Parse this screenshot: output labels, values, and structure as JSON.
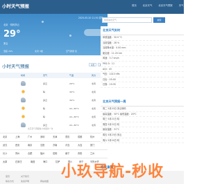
{
  "header": {
    "site_title": "小时天气预报",
    "nav": [
      "首页",
      "北京天气",
      "北京天气预报",
      "天气"
    ]
  },
  "hero": {
    "timestamp": "2025-05-20 11:30 发布",
    "location": "北京 · 晴转多云",
    "temperature": "29°",
    "condition": "多云",
    "metric_1": "湿度 28%",
    "metric_2": "北风 3级",
    "metric_3": "空气质量 优"
  },
  "forecast": {
    "title": "小时天气预报",
    "tabs": [
      "今天",
      "明天"
    ],
    "headers": [
      "时间",
      "天气",
      "气温",
      "风力"
    ],
    "rows": [
      {
        "time": "12时",
        "weather": "多云",
        "temp": "29°C",
        "wind": "北风",
        "icon": "cloud-icon"
      },
      {
        "time": "13时",
        "weather": "晴",
        "temp": "30°C",
        "wind": "北风",
        "icon": "sun-icon"
      },
      {
        "time": "14时",
        "weather": "多云",
        "temp": "30°C",
        "wind": "北风",
        "icon": "cloud-icon"
      },
      {
        "time": "15时",
        "weather": "晴",
        "temp": "22~30°C",
        "wind": "北风",
        "icon": "sun-icon"
      },
      {
        "time": "16时",
        "weather": "晴",
        "temp": "22~30°C",
        "wind": "北风",
        "icon": "sun-icon"
      },
      {
        "time": "17时",
        "weather": "多云",
        "temp": "22~30°C",
        "wind": "北风",
        "icon": "cloud-icon"
      }
    ],
    "note": "北京天气预报每小时更新一次"
  },
  "cities": [
    [
      "北京",
      "上海",
      "广州",
      "深圳",
      "天津",
      "重庆",
      "成都",
      "杭州"
    ],
    [
      "武汉",
      "西安",
      "南京",
      "沈阳",
      "济南",
      "青岛",
      "大连",
      "厦门"
    ],
    [
      "长沙",
      "郑州",
      "合肥",
      "福州",
      "昆明",
      "南宁",
      "贵阳",
      "兰州"
    ],
    [
      "太原",
      "石家庄",
      "南昌",
      "海口",
      "拉萨",
      "银川",
      "西宁",
      "乌鲁木齐"
    ]
  ],
  "sidebar": {
    "search_placeholder": "搜索城市天气",
    "search_button": "搜索",
    "realtime_title": "北京天气实时",
    "realtime_rows": [
      "体感温度：30.9 °C",
      "当前湿度：28 %",
      "当前降水量：0.00 mm",
      "能见度：11.20 km",
      "风速：3.7 km/h",
      "PM2.5：11",
      "AQI：43",
      "气压：1013 hPa",
      "日出：05:00",
      "日落：19:35"
    ],
    "forecast_title": "北京天气预报一周",
    "forecast_rows": [
      "周二 5月20日 多云转晴",
      "最高温度：30°C  最低温度：20°C",
      "周三 5月21日 晴",
      "周四 5月22日 晴",
      "最高温度：31°C",
      "周五 5月23日 多云",
      "周六 5月24日 晴"
    ],
    "hot_title": "相关查询",
    "hot_link": "北京天气 天气预报 北京"
  },
  "footer": {
    "links": [
      "首页",
      "关于我们",
      "联系方式",
      "免责声明",
      "网站地图"
    ]
  },
  "watermark": "小玖导航-秒收"
}
